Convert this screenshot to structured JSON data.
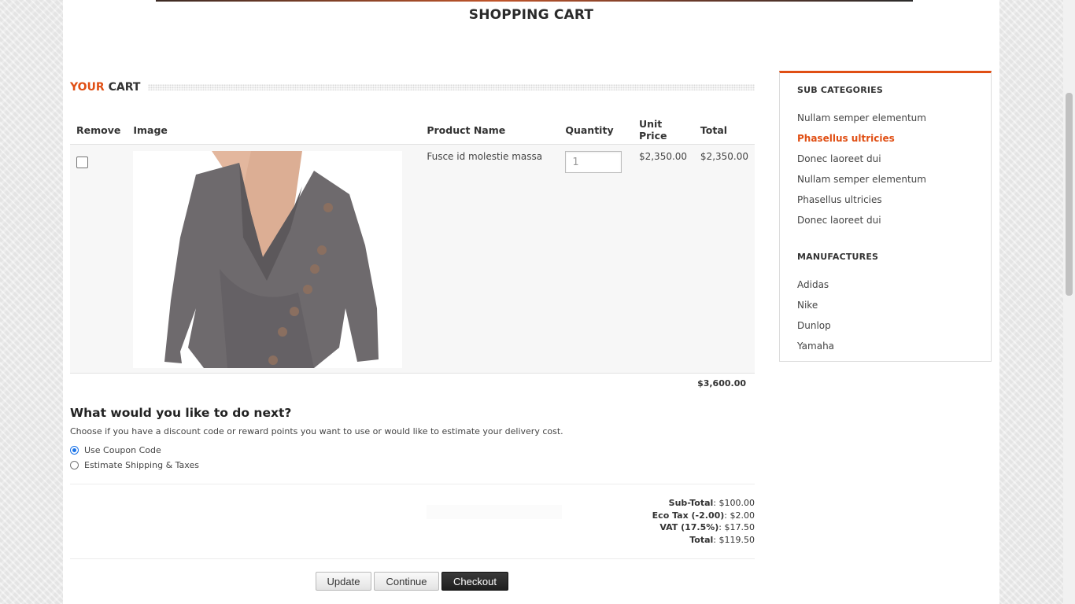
{
  "page": {
    "title": "SHOPPING CART"
  },
  "cart": {
    "heading_accent": "YOUR",
    "heading_rest": "CART",
    "columns": [
      "Remove",
      "Image",
      "Product Name",
      "Quantity",
      "Unit Price",
      "Total"
    ],
    "items": [
      {
        "name": "Fusce id molestie massa",
        "quantity_placeholder": "1",
        "unit_price": "$2,350.00",
        "total": "$2,350.00",
        "image_icon": "product-photo-sweater"
      }
    ],
    "grand_total": "$3,600.00"
  },
  "next": {
    "title": "What would you like to do next?",
    "description": "Choose if you have a discount code or reward points you want to use or would like to estimate your delivery cost.",
    "options": [
      {
        "label": "Use Coupon Code",
        "selected": true
      },
      {
        "label": "Estimate Shipping & Taxes",
        "selected": false
      }
    ]
  },
  "totals": {
    "subtotal_label": "Sub-Total",
    "subtotal_value": ": $100.00",
    "ecotax_label": "Eco Tax (-2.00)",
    "ecotax_value": ": $2.00",
    "vat_label": "VAT (17.5%)",
    "vat_value": ": $17.50",
    "total_label": "Total",
    "total_value": ": $119.50"
  },
  "buttons": {
    "update": "Update",
    "continue": "Continue",
    "checkout": "Checkout"
  },
  "sidebar": {
    "subcategories_title": "SUB CATEGORIES",
    "subcategories": [
      "Nullam semper elementum",
      "Phasellus ultricies",
      "Donec laoreet dui",
      "Nullam semper elementum",
      "Phasellus ultricies",
      "Donec laoreet dui"
    ],
    "active_index": 1,
    "manufactures_title": "MANUFACTURES",
    "manufactures": [
      "Adidas",
      "Nike",
      "Dunlop",
      "Yamaha"
    ]
  },
  "colors": {
    "accent": "#e04f14",
    "dark_button": "#222222"
  }
}
